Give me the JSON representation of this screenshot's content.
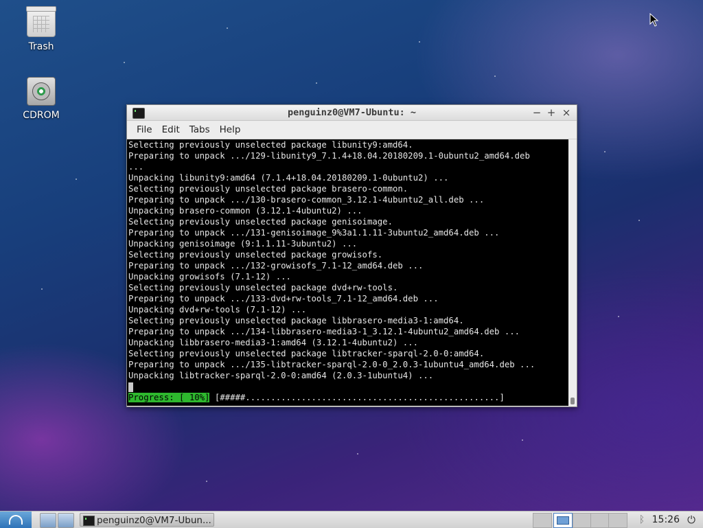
{
  "desktop": {
    "icons": [
      {
        "label": "Trash",
        "icon": "trash-icon"
      },
      {
        "label": "CDROM",
        "icon": "cdrom-icon"
      }
    ]
  },
  "window": {
    "title": "penguinz0@VM7-Ubuntu: ~",
    "controls": {
      "minimize": "−",
      "maximize": "+",
      "close": "×"
    },
    "menu": [
      "File",
      "Edit",
      "Tabs",
      "Help"
    ]
  },
  "terminal": {
    "lines": [
      "Selecting previously unselected package libunity9:amd64.",
      "Preparing to unpack .../129-libunity9_7.1.4+18.04.20180209.1-0ubuntu2_amd64.deb",
      "...",
      "Unpacking libunity9:amd64 (7.1.4+18.04.20180209.1-0ubuntu2) ...",
      "Selecting previously unselected package brasero-common.",
      "Preparing to unpack .../130-brasero-common_3.12.1-4ubuntu2_all.deb ...",
      "Unpacking brasero-common (3.12.1-4ubuntu2) ...",
      "Selecting previously unselected package genisoimage.",
      "Preparing to unpack .../131-genisoimage_9%3a1.1.11-3ubuntu2_amd64.deb ...",
      "Unpacking genisoimage (9:1.1.11-3ubuntu2) ...",
      "Selecting previously unselected package growisofs.",
      "Preparing to unpack .../132-growisofs_7.1-12_amd64.deb ...",
      "Unpacking growisofs (7.1-12) ...",
      "Selecting previously unselected package dvd+rw-tools.",
      "Preparing to unpack .../133-dvd+rw-tools_7.1-12_amd64.deb ...",
      "Unpacking dvd+rw-tools (7.1-12) ...",
      "Selecting previously unselected package libbrasero-media3-1:amd64.",
      "Preparing to unpack .../134-libbrasero-media3-1_3.12.1-4ubuntu2_amd64.deb ...",
      "Unpacking libbrasero-media3-1:amd64 (3.12.1-4ubuntu2) ...",
      "Selecting previously unselected package libtracker-sparql-2.0-0:amd64.",
      "Preparing to unpack .../135-libtracker-sparql-2.0-0_2.0.3-1ubuntu4_amd64.deb ...",
      "Unpacking libtracker-sparql-2.0-0:amd64 (2.0.3-1ubuntu4) ..."
    ],
    "progress_label": "Progress: [ 10%]",
    "progress_bar": " [#####..................................................]",
    "progress_percent": 10
  },
  "taskbar": {
    "task_label": "penguinz0@VM7-Ubun...",
    "clock": "15:26",
    "accent": "#2e73b8"
  }
}
